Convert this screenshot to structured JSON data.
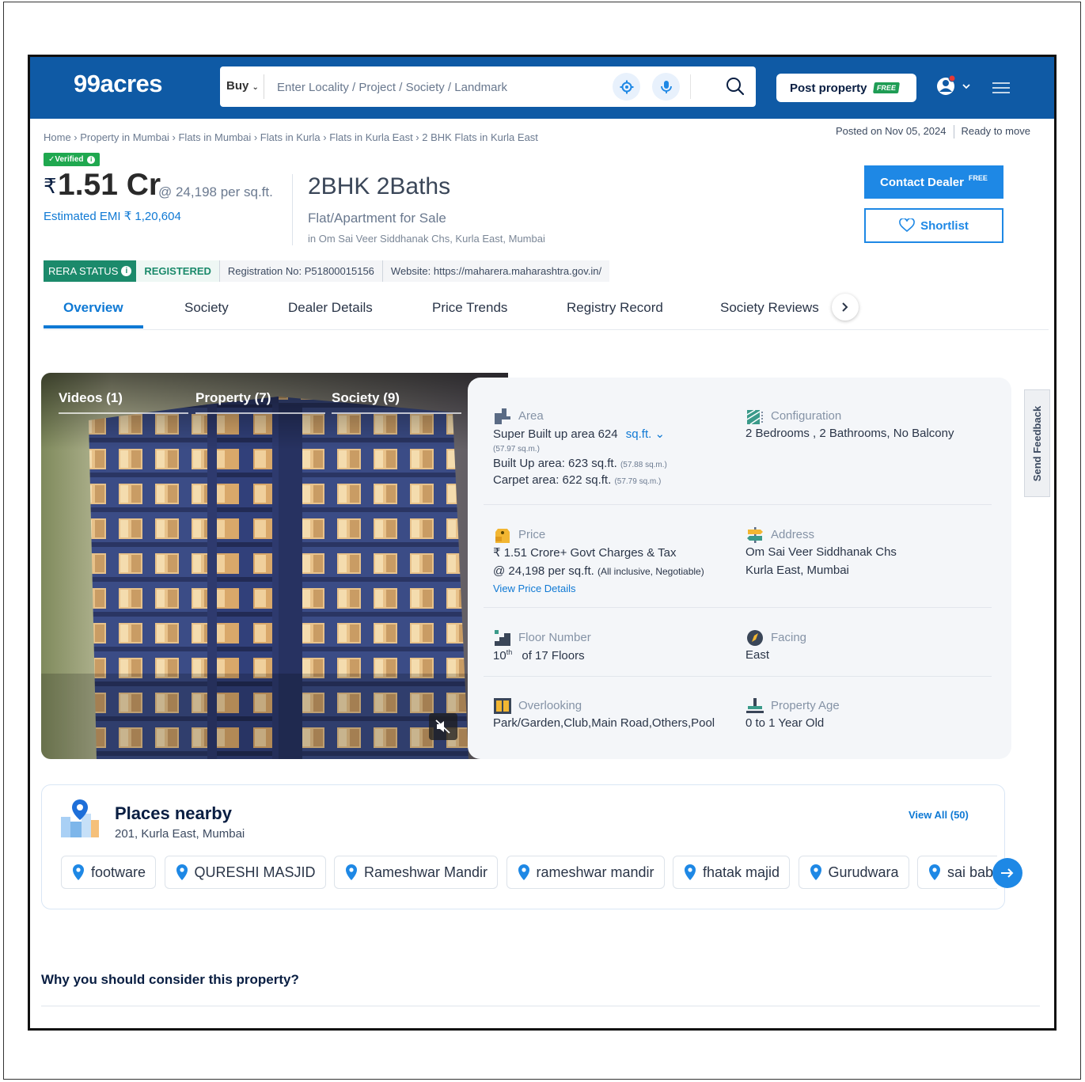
{
  "header": {
    "logo": "99acres",
    "buy_label": "Buy",
    "search_placeholder": "Enter Locality / Project / Society / Landmark",
    "post_property_label": "Post property",
    "free_label": "FREE"
  },
  "breadcrumb": "Home › Property in Mumbai › Flats in Mumbai › Flats in Kurla › Flats in Kurla East › 2 BHK Flats in Kurla East",
  "posted_on": "Posted on Nov 05, 2024",
  "status": "Ready to move",
  "verified_label": "✓Verified",
  "price": {
    "rupee": "₹",
    "amount": "1.51 Cr",
    "per_sqft": "@ 24,198 per sq.ft.",
    "emi": "Estimated EMI ₹ 1,20,604"
  },
  "listing": {
    "title": "2BHK 2Baths",
    "type": "Flat/Apartment for Sale",
    "location": "in Om Sai Veer Siddhanak Chs, Kurla East, Mumbai"
  },
  "actions": {
    "contact": "Contact Dealer",
    "contact_badge": "FREE",
    "shortlist": "Shortlist"
  },
  "rera": {
    "status_label": "RERA STATUS",
    "registered": "REGISTERED",
    "registration": "Registration No: P51800015156",
    "website": "Website: https://maharera.maharashtra.gov.in/"
  },
  "tabs": [
    "Overview",
    "Society",
    "Dealer Details",
    "Price Trends",
    "Registry Record",
    "Society Reviews"
  ],
  "media_tabs": [
    "Videos (1)",
    "Property (7)",
    "Society (9)"
  ],
  "details": {
    "area": {
      "label": "Area",
      "super_built": "Super Built up area 624",
      "unit": "sq.ft.",
      "super_sqm": "(57.97 sq.m.)",
      "built_up": "Built Up area: 623 sq.ft.",
      "built_sqm": "(57.88 sq.m.)",
      "carpet": "Carpet area: 622 sq.ft.",
      "carpet_sqm": "(57.79 sq.m.)"
    },
    "configuration": {
      "label": "Configuration",
      "value": "2 Bedrooms , 2 Bathrooms, No Balcony"
    },
    "price": {
      "label": "Price",
      "line1": "₹ 1.51 Crore+ Govt Charges & Tax",
      "line2": "@ 24,198 per sq.ft.",
      "note": "(All inclusive, Negotiable)",
      "link": "View Price Details"
    },
    "address": {
      "label": "Address",
      "line1": "Om Sai Veer Siddhanak Chs",
      "line2": "Kurla East, Mumbai"
    },
    "floor": {
      "label": "Floor Number",
      "floor": "10",
      "sup": "th",
      "of": "of 17 Floors"
    },
    "facing": {
      "label": "Facing",
      "value": "East"
    },
    "overlooking": {
      "label": "Overlooking",
      "value": "Park/Garden,Club,Main Road,Others,Pool"
    },
    "age": {
      "label": "Property Age",
      "value": "0 to 1 Year Old"
    }
  },
  "feedback_label": "Send Feedback",
  "nearby": {
    "title": "Places nearby",
    "subtitle": "201, Kurla East, Mumbai",
    "view_all": "View All (50)",
    "places": [
      "footware",
      "QURESHI MASJID",
      "Rameshwar Mandir",
      "rameshwar mandir",
      "fhatak majid",
      "Gurudwara",
      "sai baba"
    ]
  },
  "why_title": "Why you should consider this property?",
  "colors": {
    "brand": "#0f5aa5",
    "accent": "#1e88e5",
    "verified": "#1fa84f",
    "rera": "#1b8a6b"
  }
}
